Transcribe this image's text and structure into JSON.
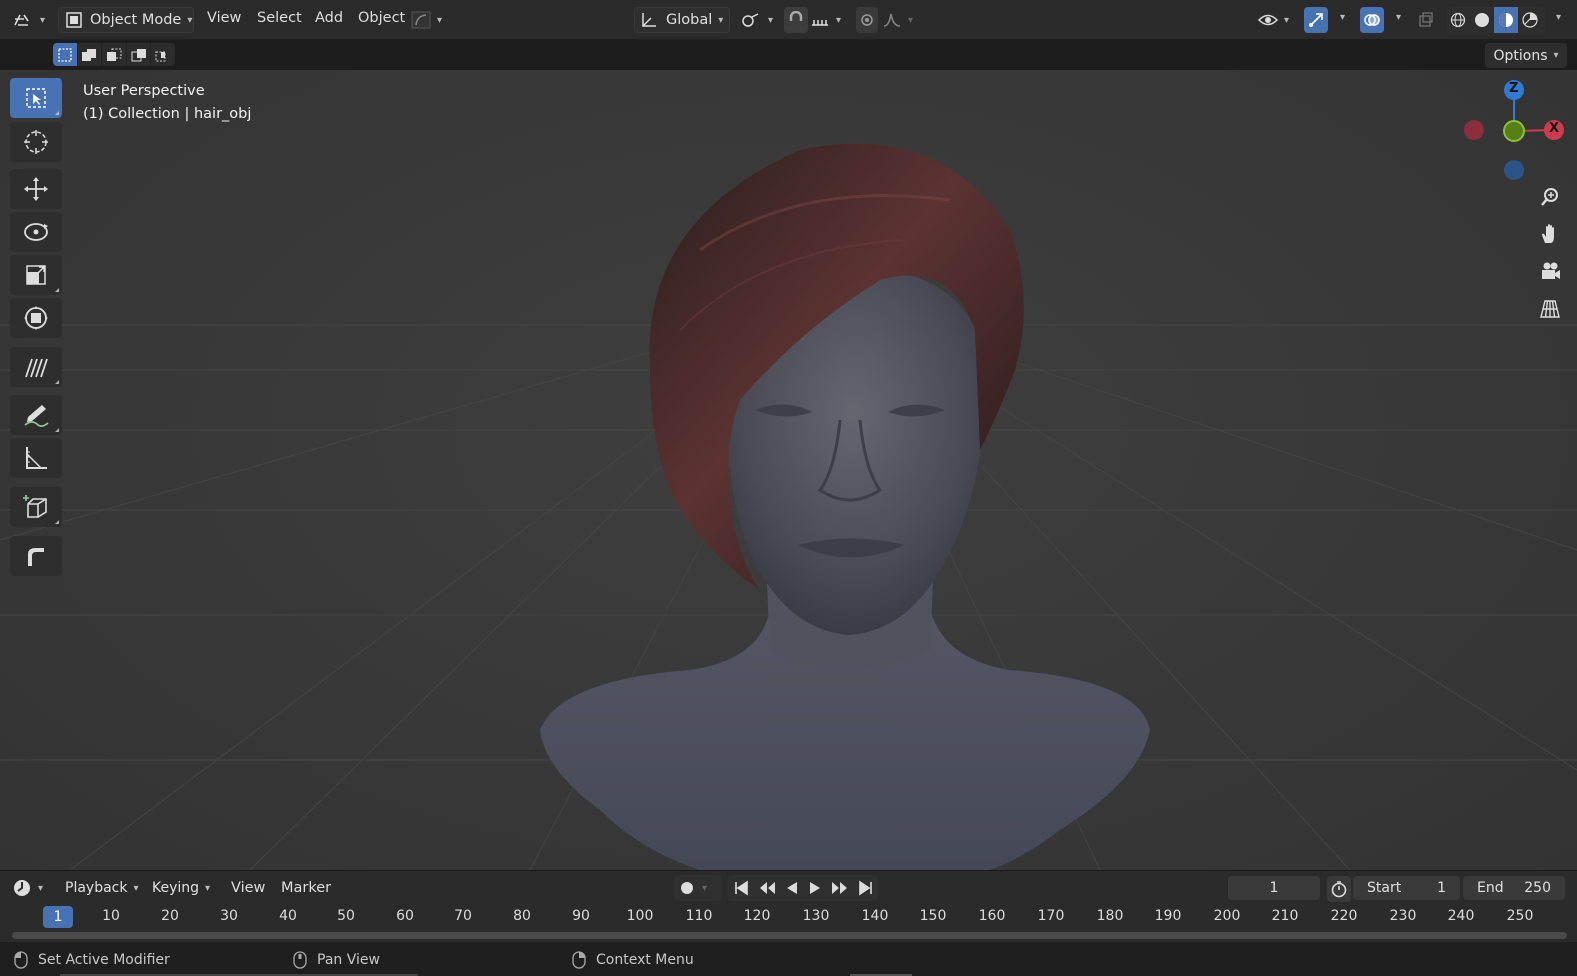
{
  "header": {
    "editor_type_icon": "editor-type-icon",
    "mode": {
      "label": "Object Mode",
      "icon": "object-mode-icon"
    },
    "menus": [
      "View",
      "Select",
      "Add",
      "Object"
    ],
    "transform_orientation": "Global",
    "viewport_shading": [
      "wireframe",
      "solid",
      "material-preview",
      "rendered"
    ]
  },
  "subrow": {
    "options_label": "Options"
  },
  "viewport": {
    "view_name": "User Perspective",
    "collection_info": "(1) Collection | hair_obj",
    "gizmo": {
      "z": "Z",
      "x": "X"
    }
  },
  "toolbar": {
    "tools": [
      "select-box",
      "cursor",
      "move",
      "rotate",
      "scale",
      "transform",
      "hair-tool",
      "annotate",
      "measure",
      "add-cube",
      "extrude"
    ]
  },
  "timeline": {
    "menus": [
      "Playback",
      "Keying",
      "View",
      "Marker"
    ],
    "current_frame": "1",
    "start_label": "Start",
    "start_value": "1",
    "end_label": "End",
    "end_value": "250",
    "ruler_current": "1",
    "ruler_ticks": [
      "10",
      "20",
      "30",
      "40",
      "50",
      "60",
      "70",
      "80",
      "90",
      "100",
      "110",
      "120",
      "130",
      "140",
      "150",
      "160",
      "170",
      "180",
      "190",
      "200",
      "210",
      "220",
      "230",
      "240",
      "250"
    ]
  },
  "statusbar": {
    "left": "Set Active Modifier",
    "middle": "Pan View",
    "right": "Context Menu"
  },
  "colors": {
    "accent": "#4772b3",
    "axis_x": "#d03a4e",
    "axis_y": "#72a81a",
    "axis_z": "#2f7ad2"
  }
}
